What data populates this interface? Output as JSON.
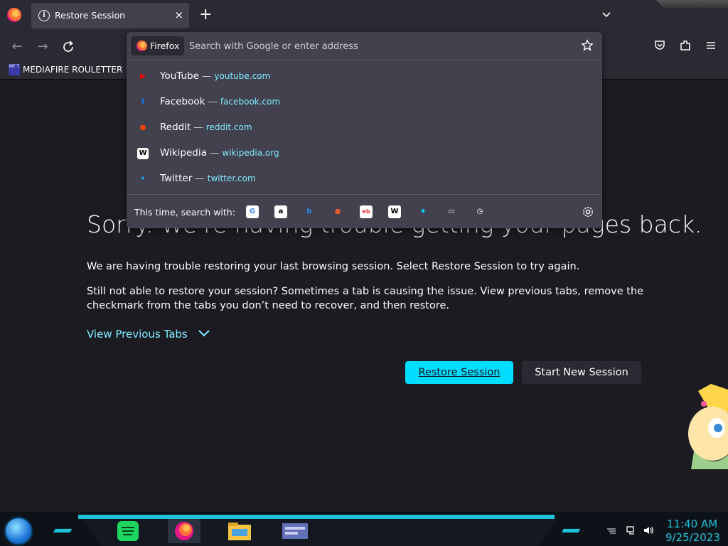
{
  "browser": {
    "tab_title": "Restore Session",
    "tab_close": "×",
    "new_tab": "+",
    "bookmark_label": "MEDIAFIRE ROULETTER",
    "bookmark_icon_text": "MF T"
  },
  "urlbar": {
    "identity_label": "Firefox",
    "placeholder": "Search with Google or enter address"
  },
  "suggestions": [
    {
      "name": "YouTube",
      "url": "youtube.com",
      "icon": "youtube-icon",
      "color": "#ff0000",
      "glyph": "▶"
    },
    {
      "name": "Facebook",
      "url": "facebook.com",
      "icon": "facebook-icon",
      "color": "#1877f2",
      "glyph": "f"
    },
    {
      "name": "Reddit",
      "url": "reddit.com",
      "icon": "reddit-icon",
      "color": "#ff4500",
      "glyph": "●"
    },
    {
      "name": "Wikipedia",
      "url": "wikipedia.org",
      "icon": "wikipedia-icon",
      "color": "#ffffff",
      "glyph": "W"
    },
    {
      "name": "Twitter",
      "url": "twitter.com",
      "icon": "twitter-icon",
      "color": "#1da1f2",
      "glyph": "✦"
    }
  ],
  "separator": "—",
  "search_engines": {
    "label": "This time, search with:",
    "engines": [
      {
        "name": "google-icon",
        "glyph": "G",
        "bg": "#ffffff",
        "fg": "#4285f4"
      },
      {
        "name": "amazon-icon",
        "glyph": "a",
        "bg": "#ffffff",
        "fg": "#000000"
      },
      {
        "name": "bing-icon",
        "glyph": "b",
        "bg": "transparent",
        "fg": "#2f8cff"
      },
      {
        "name": "duckduckgo-icon",
        "glyph": "●",
        "bg": "transparent",
        "fg": "#de5833"
      },
      {
        "name": "ebay-icon",
        "glyph": "eb",
        "bg": "#ffffff",
        "fg": "#e53238"
      },
      {
        "name": "wikipedia-engine-icon",
        "glyph": "W",
        "bg": "#ffffff",
        "fg": "#000000"
      },
      {
        "name": "bookmarks-star-icon",
        "glyph": "★",
        "bg": "transparent",
        "fg": "#00ddff"
      },
      {
        "name": "tabs-icon",
        "glyph": "▭",
        "bg": "transparent",
        "fg": "#fbfbfe"
      },
      {
        "name": "history-icon",
        "glyph": "◷",
        "bg": "transparent",
        "fg": "#fbfbfe"
      }
    ]
  },
  "page": {
    "title": "Sorry. We're having trouble getting your pages back.",
    "para1": "We are having trouble restoring your last browsing session. Select Restore Session to try again.",
    "para2": "Still not able to restore your session? Sometimes a tab is causing the issue. View previous tabs, remove the checkmark from the tabs you don’t need to recover, and then restore.",
    "view_previous": "View Previous Tabs",
    "restore_label": "Restore Session",
    "new_session_label": "Start New Session"
  },
  "taskbar": {
    "time": "11:40 AM",
    "date": "9/25/2023"
  },
  "colors": {
    "accent": "#00ddff",
    "link": "#80ebff",
    "panel": "#42414d",
    "page_bg": "#1c1b22"
  }
}
